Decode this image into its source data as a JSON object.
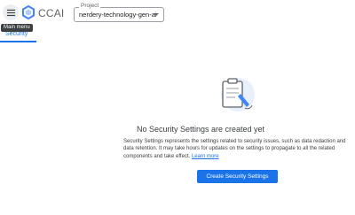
{
  "header": {
    "menu_tooltip": "Main menu",
    "app_title": "CCAI",
    "project_label": "Project",
    "project_value": "nerdery-technology-gen-ai"
  },
  "tabs": [
    {
      "label": "Security",
      "active": true
    }
  ],
  "empty_state": {
    "title": "No Security Settings are created yet",
    "description": "Security Settings represents the settings related to security issues, such as data redaction and data retention. It may take hours for updates on the settings to propagate to all the related components and take effect.",
    "learn_more": "Learn more",
    "cta_label": "Create Security Settings",
    "illustration": "clipboard-icon"
  },
  "colors": {
    "accent": "#1a73e8",
    "text": "#3c4043",
    "tooltip_bg": "#3c4043"
  },
  "icons": [
    "menu-icon",
    "ccai-logo-icon",
    "chevron-down-icon",
    "clipboard-icon"
  ]
}
